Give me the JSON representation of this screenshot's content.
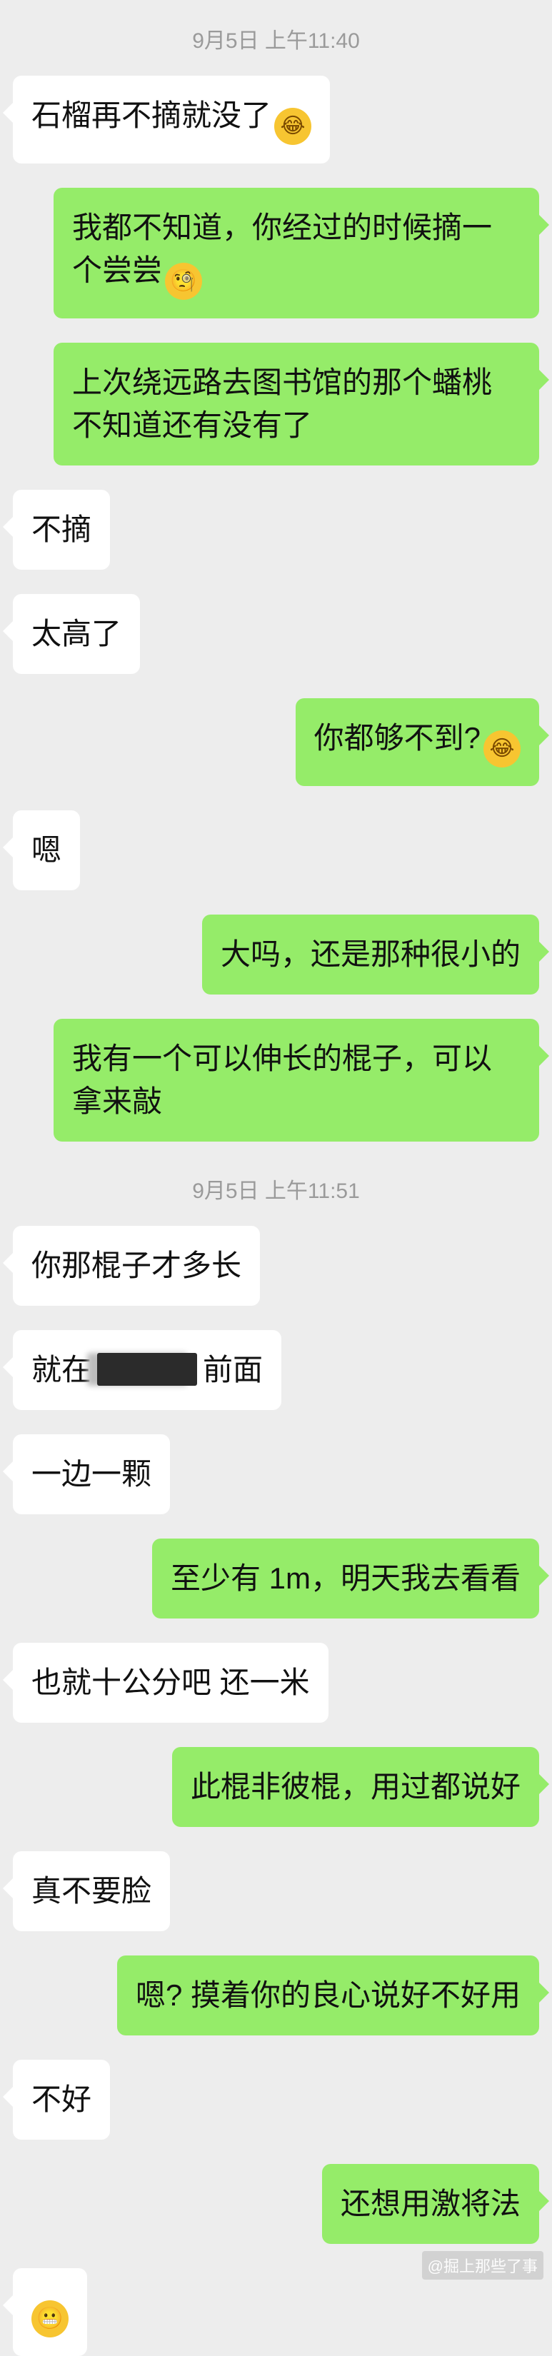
{
  "timestamps": {
    "t1": "9月5日 上午11:40",
    "t2": "9月5日 上午11:51"
  },
  "messages": [
    {
      "side": "left",
      "text": "石榴再不摘就没了",
      "emoji": "smiling-face-with-tears"
    },
    {
      "side": "right",
      "text": "我都不知道，你经过的时候摘一个尝尝",
      "emoji": "monocle-face"
    },
    {
      "side": "right",
      "text": "上次绕远路去图书馆的那个蟠桃不知道还有没有了"
    },
    {
      "side": "left",
      "text": "不摘"
    },
    {
      "side": "left",
      "text": "太高了"
    },
    {
      "side": "right",
      "text": "你都够不到?",
      "emoji": "tears-of-joy"
    },
    {
      "side": "left",
      "text": "嗯"
    },
    {
      "side": "right",
      "text": "大吗，还是那种很小的"
    },
    {
      "side": "right",
      "text": "我有一个可以伸长的棍子，可以拿来敲"
    },
    {
      "side": "left",
      "text": "你那棍子才多长"
    },
    {
      "side": "left",
      "text_before": "就在",
      "text_after": "前面"
    },
    {
      "side": "left",
      "text": "一边一颗"
    },
    {
      "side": "right",
      "text": "至少有 1m，明天我去看看"
    },
    {
      "side": "left",
      "text": "也就十公分吧 还一米"
    },
    {
      "side": "right",
      "text": "此棍非彼棍，用过都说好"
    },
    {
      "side": "left",
      "text": "真不要脸"
    },
    {
      "side": "right",
      "text": "嗯? 摸着你的良心说好不好用"
    },
    {
      "side": "left",
      "text": "不好"
    },
    {
      "side": "right",
      "text": "还想用激将法"
    },
    {
      "side": "left",
      "emoji": "grimacing-face"
    }
  ],
  "watermark": "@掘上那些了事"
}
